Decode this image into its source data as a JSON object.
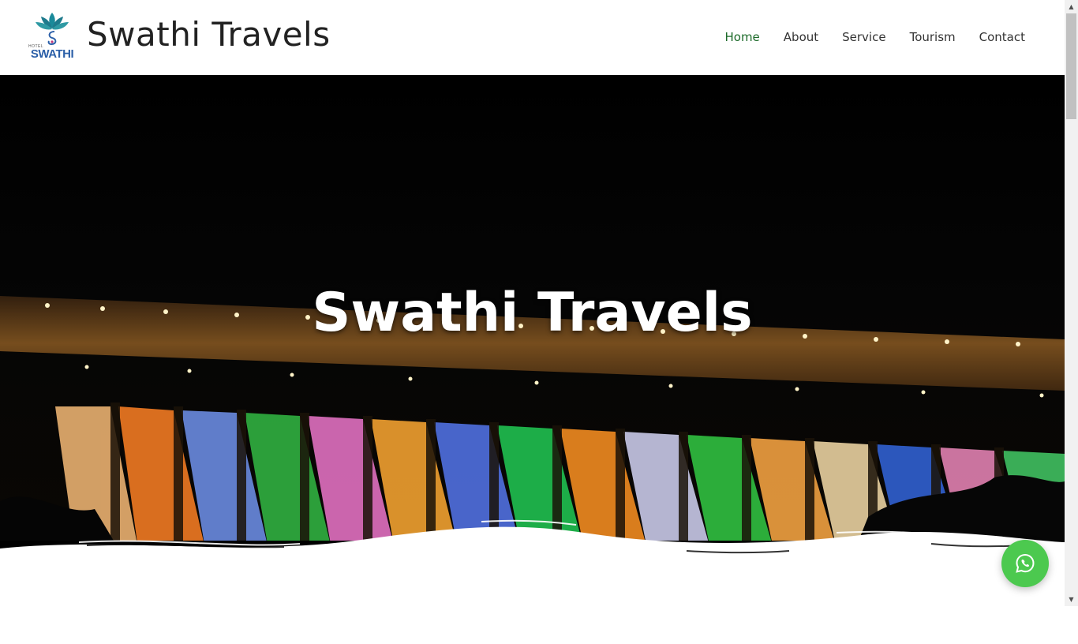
{
  "header": {
    "logo": {
      "small_text": "HOTEL",
      "name_text": "SWATHI"
    },
    "site_title": "Swathi Travels",
    "nav": [
      {
        "label": "Home",
        "active": true
      },
      {
        "label": "About",
        "active": false
      },
      {
        "label": "Service",
        "active": false
      },
      {
        "label": "Tourism",
        "active": false
      },
      {
        "label": "Contact",
        "active": false
      }
    ]
  },
  "hero": {
    "title": "Swathi Travels"
  },
  "floating": {
    "whatsapp_icon": "whatsapp-icon"
  },
  "colors": {
    "nav_active": "#1d6b2a",
    "whatsapp": "#4cc94f",
    "logo_blue": "#2b5fa8",
    "logo_teal": "#1a8a9a"
  }
}
